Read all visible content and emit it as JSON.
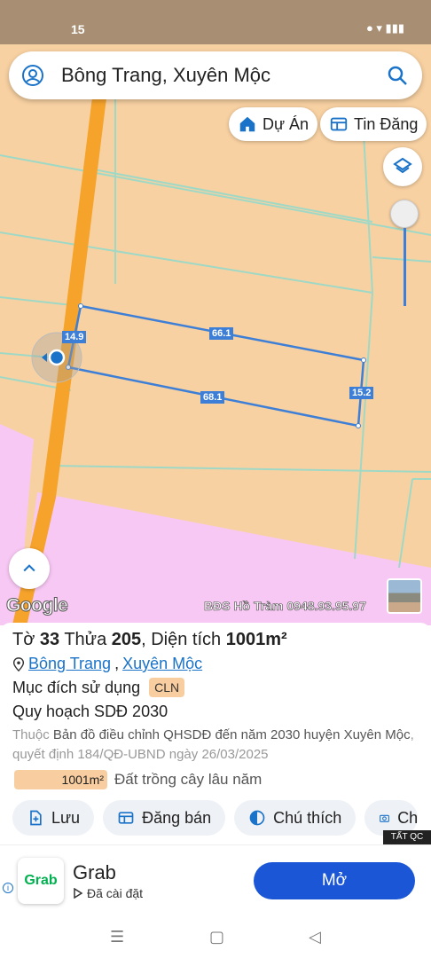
{
  "status": {
    "time": "15"
  },
  "search": {
    "text": "Bông Trang, Xuyên Mộc"
  },
  "map": {
    "chips": {
      "project": "Dự Án",
      "listings": "Tin Đăng"
    },
    "measurements": {
      "top": "66.1",
      "bottom": "68.1",
      "left": "14.9",
      "right": "15.2"
    },
    "google": "Google",
    "watermark": "BĐS Hồ Tràm 0948.93.95.97"
  },
  "parcel": {
    "title_prefix": "Tờ ",
    "sheet": "33",
    "plot_prefix": " Thửa ",
    "plot": "205",
    "area_prefix": ", Diện tích ",
    "area": "1001m²",
    "location_1": "Bông Trang",
    "location_sep": ", ",
    "location_2": "Xuyên Mộc",
    "purpose_label": "Mục đích sử dụng",
    "purpose_code": "CLN",
    "plan_title": "Quy hoạch SDĐ 2030",
    "plan_desc_gray1": "Thuộc ",
    "plan_desc_main": "Bản đồ điều chỉnh QHSDĐ đến năm 2030 huyện Xuyên Mộc",
    "plan_desc_gray2": ", quyết định 184/QĐ-UBND ngày 26/03/2025",
    "area_value": "1001m²",
    "land_type": "Đất trồng cây lâu năm"
  },
  "actions": {
    "save": "Lưu",
    "post": "Đăng bán",
    "legend": "Chú thích",
    "capture": "Ch"
  },
  "ad": {
    "tag": "TẤT QC",
    "logo_text": "Grab",
    "name": "Grab",
    "installed": "Đã cài đặt",
    "open": "Mở"
  },
  "colors": {
    "parcel_line": "#3d7fd6",
    "road": "#f6a32b",
    "pink_zone": "#f8c8f4",
    "base": "#f8d1a2"
  }
}
